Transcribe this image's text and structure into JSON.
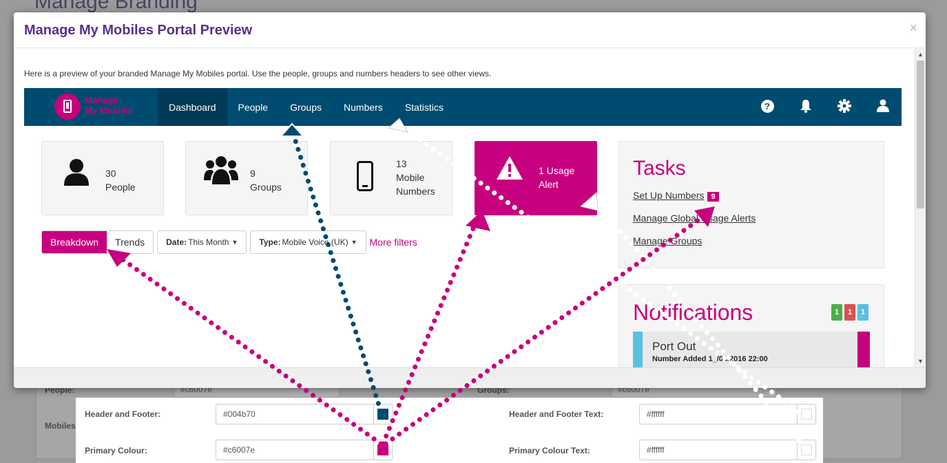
{
  "background_page": {
    "title": "Manage Branding",
    "people_label": "People:",
    "people_value": "#c6007e",
    "groups_label": "Groups:",
    "groups_value": "#c6007e",
    "mobiles_label": "Mobiles"
  },
  "modal": {
    "title": "Manage My Mobiles Portal Preview",
    "close": "×",
    "intro": "Here is a preview of your branded Manage My Mobiles portal. Use the people, groups and numbers headers to see other views."
  },
  "portal": {
    "logo_line1": "Manage",
    "logo_line2": "My Mobiles",
    "nav": [
      "Dashboard",
      "People",
      "Groups",
      "Numbers",
      "Statistics"
    ],
    "icons": [
      "help-icon",
      "bell-icon",
      "gear-icon",
      "user-icon"
    ],
    "stats": [
      {
        "value": "30",
        "label": "People",
        "icon": "person-icon"
      },
      {
        "value": "9",
        "label": "Groups",
        "icon": "group-icon"
      },
      {
        "value": "13",
        "label_line1": "Mobile",
        "label_line2": "Numbers",
        "icon": "mobile-phone-icon"
      },
      {
        "value": "1",
        "label_line1": "1 Usage",
        "label_line2": "Alert",
        "icon": "warning-icon"
      }
    ],
    "tasks": {
      "title": "Tasks",
      "items": [
        {
          "label": "Set Up Numbers",
          "badge": "9"
        },
        {
          "label": "Manage Global Usage Alerts"
        },
        {
          "label": "Manage Groups"
        }
      ]
    },
    "notifications": {
      "title": "Notifications",
      "badges": [
        {
          "value": "1",
          "color": "#4cae4c"
        },
        {
          "value": "1",
          "color": "#d9534f"
        },
        {
          "value": "1",
          "color": "#5bc0de"
        }
      ],
      "item_title": "Port Out",
      "item_sub": "Number Added 1_/04/2016 22:00"
    },
    "filters": {
      "breakdown": "Breakdown",
      "trends": "Trends",
      "date_label": "Date:",
      "date_value": "This Month",
      "type_label": "Type:",
      "type_value": "Mobile Voice (UK)",
      "more": "More filters"
    }
  },
  "config": {
    "header_footer_label": "Header and Footer:",
    "header_footer_value": "#004b70",
    "header_footer_text_label": "Header and Footer Text:",
    "header_footer_text_value": "#ffffff",
    "primary_label": "Primary Colour:",
    "primary_value": "#c6007e",
    "primary_text_label": "Primary Colour Text:",
    "primary_text_value": "#ffffff"
  },
  "colors": {
    "header": "#004b70",
    "primary": "#c6007e",
    "white": "#ffffff",
    "modal_title": "#5b2d8e"
  }
}
